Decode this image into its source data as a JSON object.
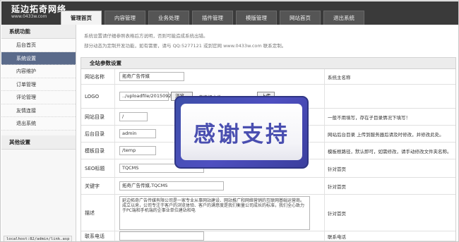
{
  "header": {
    "logo_title": "延边拓奇网络",
    "logo_url": "www.0433w.com",
    "tabs": [
      "管理首页",
      "内容管理",
      "业务处理",
      "插件管理",
      "模版管理",
      "网站首页",
      "退出系统"
    ],
    "active_tab": "管理首页"
  },
  "sidebar": {
    "groups": [
      {
        "title": "系统功能",
        "items": [
          "后台首页",
          "系统设置",
          "内容维护",
          "订单管理",
          "评论管理",
          "友情连接",
          "退出系统"
        ],
        "active_item": "系统设置"
      },
      {
        "title": "其他设置",
        "items": []
      }
    ]
  },
  "main": {
    "intro_line1": "系统设置请仔细参照表格后方说明，否则可能造成系统出错。",
    "intro_line2": "部分动态为定制开发功能，如有需要，请与 QQ:5277121 或到官网 www.0433w.com 联系定制。",
    "section_title": "全站参数设置",
    "rows": [
      {
        "label": "网站名称",
        "value": "拓奇广告传媒",
        "note": "系统主名称"
      },
      {
        "label": "LOGO",
        "value": "../uploadfile/20150921/",
        "browse": "浏览...",
        "no_file": "未选择文件。",
        "upload": "上传",
        "note": ""
      },
      {
        "label": "网站目录",
        "value": "/",
        "note": "一般不用填写，存在子目录情况下填写！"
      },
      {
        "label": "后台目录",
        "value": "admin",
        "note": "网站后台目录 上传到服务器后请及时修改，并修改此处。"
      },
      {
        "label": "模板目录",
        "value": "/temp",
        "note": "模板根路径，默认即可，如需修改，请手动修改文件夹名称。"
      },
      {
        "label": "SEO标题",
        "value": "TQCMS",
        "note": "针对首页"
      },
      {
        "label": "关键字",
        "value": "拓奇广告传媒,TQCMS",
        "note": "针对首页"
      },
      {
        "label": "描述",
        "value": "延边拓奇广告传媒有限公司是一家专业从事网站建设、网站推广和网络营销的互联网基础运营商。成立以来，公司专注于客户的浏览体验、客户的满意度是我们衡量公司成长的标准，我们全心致力于PC端和手机端的企事业单位建站和电",
        "note": "针对首页"
      },
      {
        "label": "联系电话",
        "value": "",
        "note": "联系电话"
      }
    ]
  },
  "overlay": {
    "text": "感谢支持"
  },
  "status_bar": "localhost:82/admin/link.asp"
}
